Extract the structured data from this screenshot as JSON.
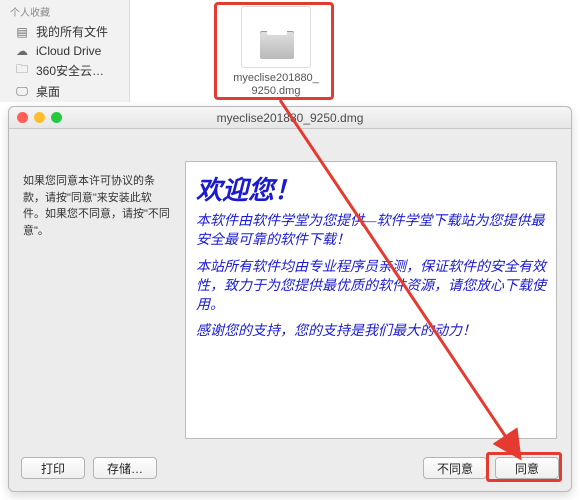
{
  "sidebar": {
    "header": "个人收藏",
    "items": [
      {
        "label": "我的所有文件",
        "icon": "drive-icon"
      },
      {
        "label": "iCloud Drive",
        "icon": "cloud-icon"
      },
      {
        "label": "360安全云…",
        "icon": "folder-icon"
      },
      {
        "label": "桌面",
        "icon": "desktop-icon"
      }
    ]
  },
  "file": {
    "name_line1": "myeclise201880_",
    "name_line2": "9250.dmg"
  },
  "installer": {
    "title": "myeclise201880_9250.dmg",
    "instructions": "如果您同意本许可协议的条款，请按\"同意\"来安装此软件。如果您不同意，请按\"不同意\"。"
  },
  "license": {
    "heading": "欢迎您！",
    "p1": "本软件由软件学堂为您提供—软件学堂下载站为您提供最安全最可靠的软件下载！",
    "p2": "本站所有软件均由专业程序员亲测，保证软件的安全有效性，致力于为您提供最优质的软件资源，请您放心下载使用。",
    "p3": "感谢您的支持，您的支持是我们最大的动力！"
  },
  "buttons": {
    "print": "打印",
    "save": "存储…",
    "disagree": "不同意",
    "agree": "同意"
  },
  "colors": {
    "highlight": "#e53a2f"
  }
}
